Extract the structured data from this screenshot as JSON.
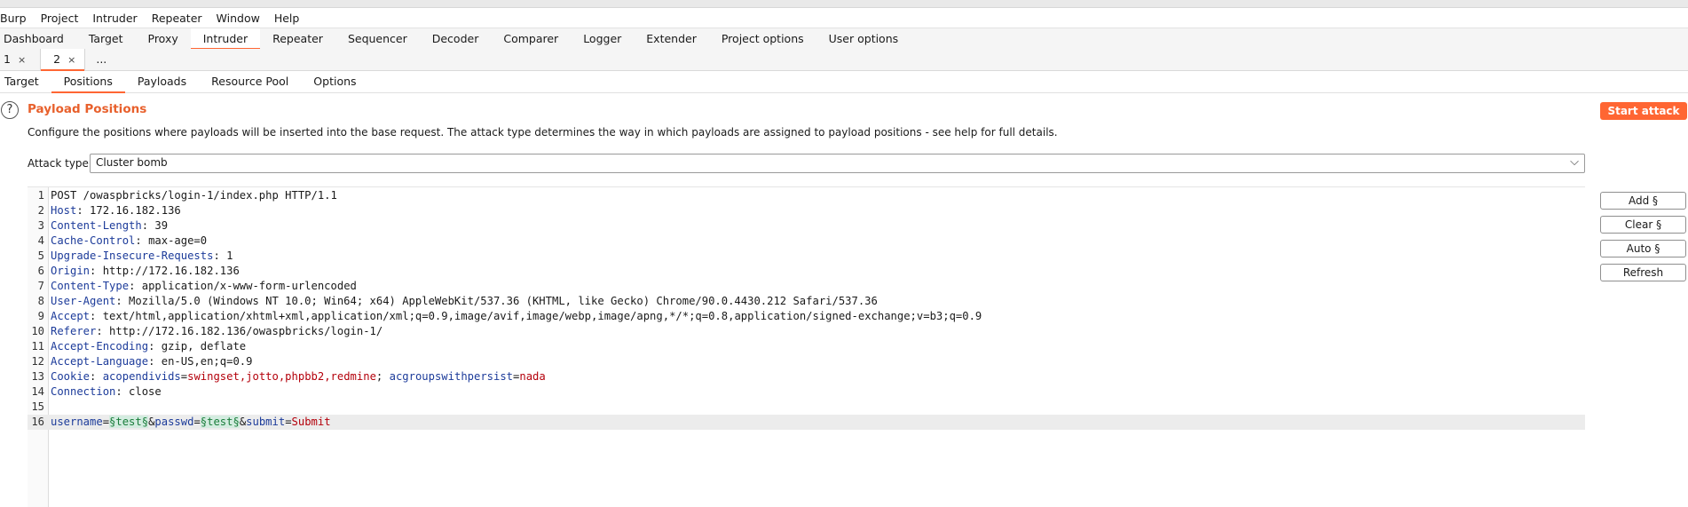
{
  "menu": [
    "Burp",
    "Project",
    "Intruder",
    "Repeater",
    "Window",
    "Help"
  ],
  "main_tabs": [
    "Dashboard",
    "Target",
    "Proxy",
    "Intruder",
    "Repeater",
    "Sequencer",
    "Decoder",
    "Comparer",
    "Logger",
    "Extender",
    "Project options",
    "User options"
  ],
  "main_active": "Intruder",
  "attack_tabs": [
    {
      "label": "1",
      "close": "×"
    },
    {
      "label": "2",
      "close": "×"
    },
    {
      "label": "...",
      "close": ""
    }
  ],
  "attack_active": "2",
  "sub_tabs": [
    "Target",
    "Positions",
    "Payloads",
    "Resource Pool",
    "Options"
  ],
  "sub_active": "Positions",
  "help_glyph": "?",
  "section": {
    "title": "Payload Positions",
    "description": "Configure the positions where payloads will be inserted into the base request. The attack type determines the way in which payloads are assigned to payload positions - see help for full details."
  },
  "start_attack": "Start attack",
  "attack_type": {
    "label": "Attack type:",
    "value": "Cluster bomb"
  },
  "side_buttons": [
    "Add §",
    "Clear §",
    "Auto §",
    "Refresh"
  ],
  "request_lines": [
    {
      "n": "1",
      "parts": [
        {
          "t": "POST /owaspbricks/login-1/index.php HTTP/1.1",
          "c": "v"
        }
      ]
    },
    {
      "n": "2",
      "parts": [
        {
          "t": "Host",
          "c": "k"
        },
        {
          "t": ": 172.16.182.136",
          "c": "v"
        }
      ]
    },
    {
      "n": "3",
      "parts": [
        {
          "t": "Content-Length",
          "c": "k"
        },
        {
          "t": ": 39",
          "c": "v"
        }
      ]
    },
    {
      "n": "4",
      "parts": [
        {
          "t": "Cache-Control",
          "c": "k"
        },
        {
          "t": ": max-age=0",
          "c": "v"
        }
      ]
    },
    {
      "n": "5",
      "parts": [
        {
          "t": "Upgrade-Insecure-Requests",
          "c": "k"
        },
        {
          "t": ": 1",
          "c": "v"
        }
      ]
    },
    {
      "n": "6",
      "parts": [
        {
          "t": "Origin",
          "c": "k"
        },
        {
          "t": ": http://172.16.182.136",
          "c": "v"
        }
      ]
    },
    {
      "n": "7",
      "parts": [
        {
          "t": "Content-Type",
          "c": "k"
        },
        {
          "t": ": application/x-www-form-urlencoded",
          "c": "v"
        }
      ]
    },
    {
      "n": "8",
      "parts": [
        {
          "t": "User-Agent",
          "c": "k"
        },
        {
          "t": ": Mozilla/5.0 (Windows NT 10.0; Win64; x64) AppleWebKit/537.36 (KHTML, like Gecko) Chrome/90.0.4430.212 Safari/537.36",
          "c": "v"
        }
      ]
    },
    {
      "n": "9",
      "parts": [
        {
          "t": "Accept",
          "c": "k"
        },
        {
          "t": ": text/html,application/xhtml+xml,application/xml;q=0.9,image/avif,image/webp,image/apng,*/*;q=0.8,application/signed-exchange;v=b3;q=0.9",
          "c": "v"
        }
      ]
    },
    {
      "n": "10",
      "parts": [
        {
          "t": "Referer",
          "c": "k"
        },
        {
          "t": ": http://172.16.182.136/owaspbricks/login-1/",
          "c": "v"
        }
      ]
    },
    {
      "n": "11",
      "parts": [
        {
          "t": "Accept-Encoding",
          "c": "k"
        },
        {
          "t": ": gzip, deflate",
          "c": "v"
        }
      ]
    },
    {
      "n": "12",
      "parts": [
        {
          "t": "Accept-Language",
          "c": "k"
        },
        {
          "t": ": en-US,en;q=0.9",
          "c": "v"
        }
      ]
    },
    {
      "n": "13",
      "parts": [
        {
          "t": "Cookie",
          "c": "k"
        },
        {
          "t": ": ",
          "c": "v"
        },
        {
          "t": "acopendivids",
          "c": "k"
        },
        {
          "t": "=",
          "c": "v"
        },
        {
          "t": "swingset,jotto,phpbb2,redmine",
          "c": "cv"
        },
        {
          "t": "; ",
          "c": "v"
        },
        {
          "t": "acgroupswithpersist",
          "c": "k"
        },
        {
          "t": "=",
          "c": "v"
        },
        {
          "t": "nada",
          "c": "cv"
        }
      ]
    },
    {
      "n": "14",
      "parts": [
        {
          "t": "Connection",
          "c": "k"
        },
        {
          "t": ": close",
          "c": "v"
        }
      ]
    },
    {
      "n": "15",
      "parts": []
    },
    {
      "n": "16",
      "highlight": true,
      "parts": [
        {
          "t": "username",
          "c": "k"
        },
        {
          "t": "=",
          "c": "v"
        },
        {
          "t": "§test§",
          "c": "pay"
        },
        {
          "t": "&",
          "c": "v"
        },
        {
          "t": "passwd",
          "c": "k"
        },
        {
          "t": "=",
          "c": "v"
        },
        {
          "t": "§test§",
          "c": "pay"
        },
        {
          "t": "&",
          "c": "v"
        },
        {
          "t": "submit",
          "c": "k"
        },
        {
          "t": "=",
          "c": "v"
        },
        {
          "t": "Submit",
          "c": "cv"
        }
      ]
    }
  ]
}
